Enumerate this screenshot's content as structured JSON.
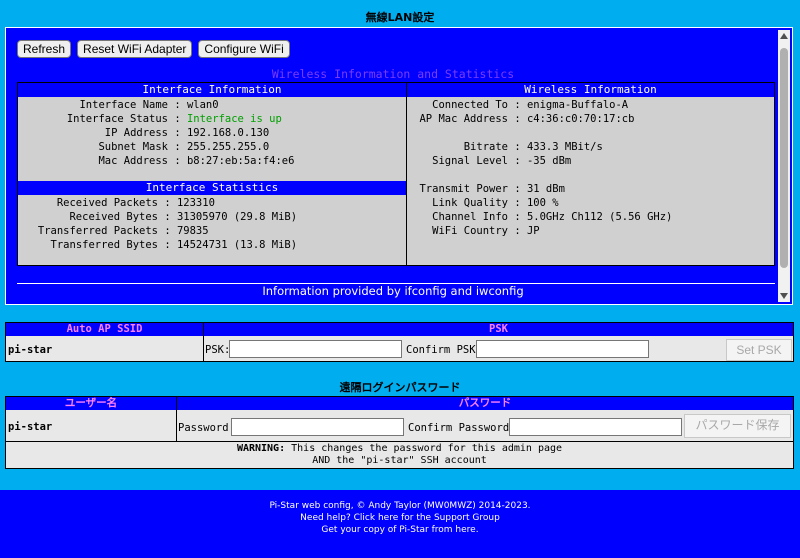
{
  "wifi_section": {
    "title": "無線LAN設定",
    "buttons": {
      "refresh": "Refresh",
      "reset": "Reset WiFi Adapter",
      "configure": "Configure WiFi"
    },
    "heading": "Wireless Information and Statistics",
    "interface_info": {
      "header": "Interface Information",
      "rows": [
        {
          "key": "Interface Name",
          "value": "wlan0"
        },
        {
          "key": "Interface Status",
          "value": "Interface is up"
        },
        {
          "key": "IP Address",
          "value": "192.168.0.130"
        },
        {
          "key": "Subnet Mask",
          "value": "255.255.255.0"
        },
        {
          "key": "Mac Address",
          "value": "b8:27:eb:5a:f4:e6"
        }
      ]
    },
    "interface_stats": {
      "header": "Interface Statistics",
      "rows": [
        {
          "key": "Received Packets",
          "value": "123310"
        },
        {
          "key": "Received Bytes",
          "value": "31305970 (29.8 MiB)"
        },
        {
          "key": "Transferred Packets",
          "value": "79835"
        },
        {
          "key": "Transferred Bytes",
          "value": "14524731 (13.8 MiB)"
        }
      ]
    },
    "wireless_info": {
      "header": "Wireless Information",
      "rows_a": [
        {
          "key": "Connected To",
          "value": "enigma-Buffalo-A"
        },
        {
          "key": "AP Mac Address",
          "value": "c4:36:c0:70:17:cb"
        }
      ],
      "rows_b": [
        {
          "key": "Bitrate",
          "value": "433.3 MBit/s"
        },
        {
          "key": "Signal Level",
          "value": "-35 dBm"
        }
      ],
      "rows_c": [
        {
          "key": "Transmit Power",
          "value": "31 dBm"
        },
        {
          "key": "Link Quality",
          "value": "100 %"
        },
        {
          "key": "Channel Info",
          "value": "5.0GHz Ch112 (5.56 GHz)"
        },
        {
          "key": "WiFi Country",
          "value": "JP"
        }
      ]
    },
    "footer": "Information provided by ifconfig and iwconfig"
  },
  "ap_section": {
    "col1_header": "Auto AP SSID",
    "col2_header": "PSK",
    "ssid_value": "pi-star",
    "psk_label": "PSK:",
    "confirm_label": "Confirm PSK:",
    "set_button": "Set PSK"
  },
  "password_section": {
    "title": "遠隔ログインパスワード",
    "col1_header": "ユーザー名",
    "col2_header": "パスワード",
    "user_value": "pi-star",
    "password_label": "Password:",
    "confirm_label": "Confirm Password:",
    "save_button": "パスワード保存",
    "warning_bold": "WARNING:",
    "warning_rest": " This changes the password for this admin page",
    "warning_line2": "AND the \"pi-star\" SSH account"
  },
  "footer": {
    "line1": "Pi-Star web config, © Andy Taylor (MW0MWZ) 2014-2023.",
    "line2": "Need help? Click here for the Support Group",
    "line3": "Get your copy of Pi-Star from here."
  },
  "colors": {
    "page_bg": "#00aeef",
    "panel_blue": "#0000ff",
    "status_green": "#00a000"
  }
}
